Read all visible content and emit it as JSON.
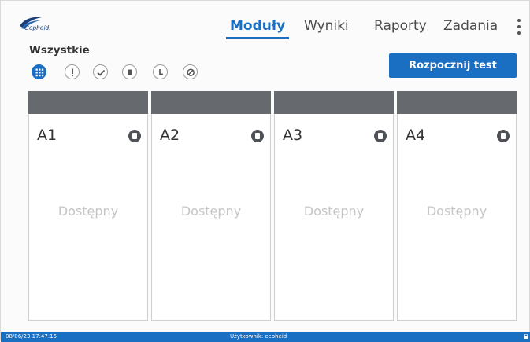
{
  "header": {
    "logo_text": "Cepheid.",
    "tabs": [
      {
        "label": "Moduły",
        "active": true
      },
      {
        "label": "Wyniki",
        "active": false
      },
      {
        "label": "Raporty",
        "active": false
      },
      {
        "label": "Zadania",
        "active": false
      }
    ]
  },
  "filters": {
    "title": "Wszystkie",
    "items": [
      {
        "icon": "grid-icon",
        "selected": true
      },
      {
        "icon": "alert-icon",
        "selected": false
      },
      {
        "icon": "check-icon",
        "selected": false
      },
      {
        "icon": "stop-icon",
        "selected": false
      },
      {
        "icon": "clock-icon",
        "selected": false
      },
      {
        "icon": "blocked-icon",
        "selected": false
      }
    ]
  },
  "actions": {
    "start_test_label": "Rozpocznij test"
  },
  "modules": [
    {
      "name": "A1",
      "status": "Dostępny"
    },
    {
      "name": "A2",
      "status": "Dostępny"
    },
    {
      "name": "A3",
      "status": "Dostępny"
    },
    {
      "name": "A4",
      "status": "Dostępny"
    }
  ],
  "statusbar": {
    "datetime": "08/06/23 17:47:15",
    "user": "Użytkownik: cepheid"
  },
  "colors": {
    "accent": "#1b6fc2",
    "module_header": "#666a6f",
    "status_text": "#c6c6c6"
  }
}
